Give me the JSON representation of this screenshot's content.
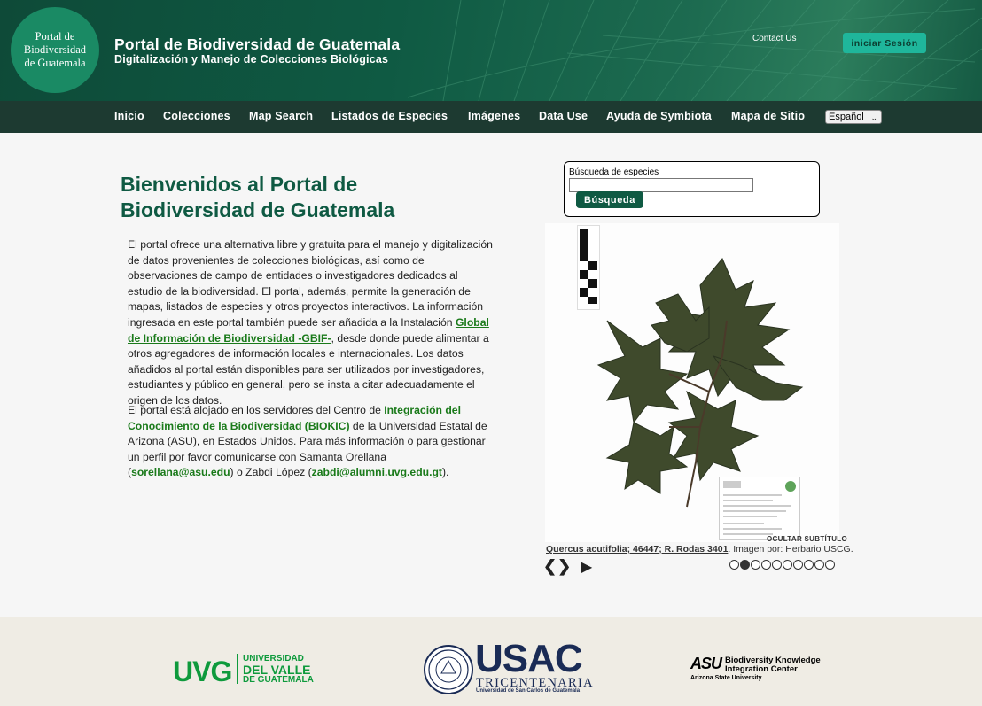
{
  "header": {
    "logo_lines": [
      "Portal de",
      "Biodiversidad",
      "de Guatemala"
    ],
    "title": "Portal de Biodiversidad de Guatemala",
    "subtitle": "Digitalización y Manejo de Colecciones Biológicas",
    "contact": "Contact Us",
    "login": "iniciar Sesión"
  },
  "nav": {
    "items": [
      "Inicio",
      "Colecciones",
      "Map Search",
      "Listados de Especies",
      "Imágenes",
      "Data Use",
      "Ayuda de Symbiota",
      "Mapa de Sitio"
    ],
    "language": "Español"
  },
  "main": {
    "title_line1": "Bienvenidos al Portal de",
    "title_line2": "Biodiversidad de Guatemala",
    "p1_a": "El portal ofrece una alternativa libre y gratuita para el manejo y digitalización de datos provenientes de colecciones biológicas, así como de observaciones de campo de entidades o investigadores dedicados al estudio de la biodiversidad. El portal, además, permite la generación de mapas, listados de especies y otros proyectos interactivos. La información ingresada en este portal también puede ser añadida a la Instalación ",
    "p1_link": "Global de Información de Biodiversidad -GBIF-",
    "p1_b": ", desde donde puede alimentar a otros agregadores de información locales e internacionales. Los datos añadidos al portal están disponibles para ser utilizados por investigadores, estudiantes y público en general, pero se insta a citar adecuadamente el origen de los datos.",
    "p2_a": "El portal está alojado en los servidores del Centro de ",
    "p2_link1": "Integración del Conocimiento de la Biodiversidad (BIOKIC)",
    "p2_b": " de la Universidad Estatal de Arizona (ASU), en Estados Unidos. Para más información o para gestionar un perfil por favor comunicarse con Samanta Orellana (",
    "p2_link2": "sorellana@asu.edu",
    "p2_c": ") o Zabdi López (",
    "p2_link3": "zabdi@alumni.uvg.edu.gt",
    "p2_d": ")."
  },
  "search": {
    "label": "Búsqueda de especies",
    "button": "Búsqueda",
    "value": ""
  },
  "slideshow": {
    "hide_caption": "OCULTAR SUBTÍTULO",
    "caption_link": "Quercus acutifolia; 46447; R. Rodas 3401",
    "caption_rest": ". Imagen por: Herbario USCG.",
    "arrows": "❮❯",
    "play": "▶",
    "dot_count": 10,
    "active_dot": 1
  },
  "footer": {
    "uvg": "UVG",
    "uvg_line1": "UNIVERSIDAD",
    "uvg_line2": "DEL VALLE",
    "uvg_line3": "DE GUATEMALA",
    "usac": "USAC",
    "usac_sub": "TRICENTENARIA",
    "usac_sub2": "Universidad de San Carlos de Guatemala",
    "asu": "ASU",
    "biokic_line1": "Biodiversity Knowledge",
    "biokic_line2": "Integration Center",
    "asu_sub": "Arizona State University"
  },
  "colors": {
    "header_bg": "#0f5a43",
    "nav_bg": "#1d3a31",
    "login_btn": "#1fb69b",
    "link_green": "#1a7a1a",
    "uvg_green": "#0e9a3c",
    "usac_navy": "#1a2b55"
  }
}
